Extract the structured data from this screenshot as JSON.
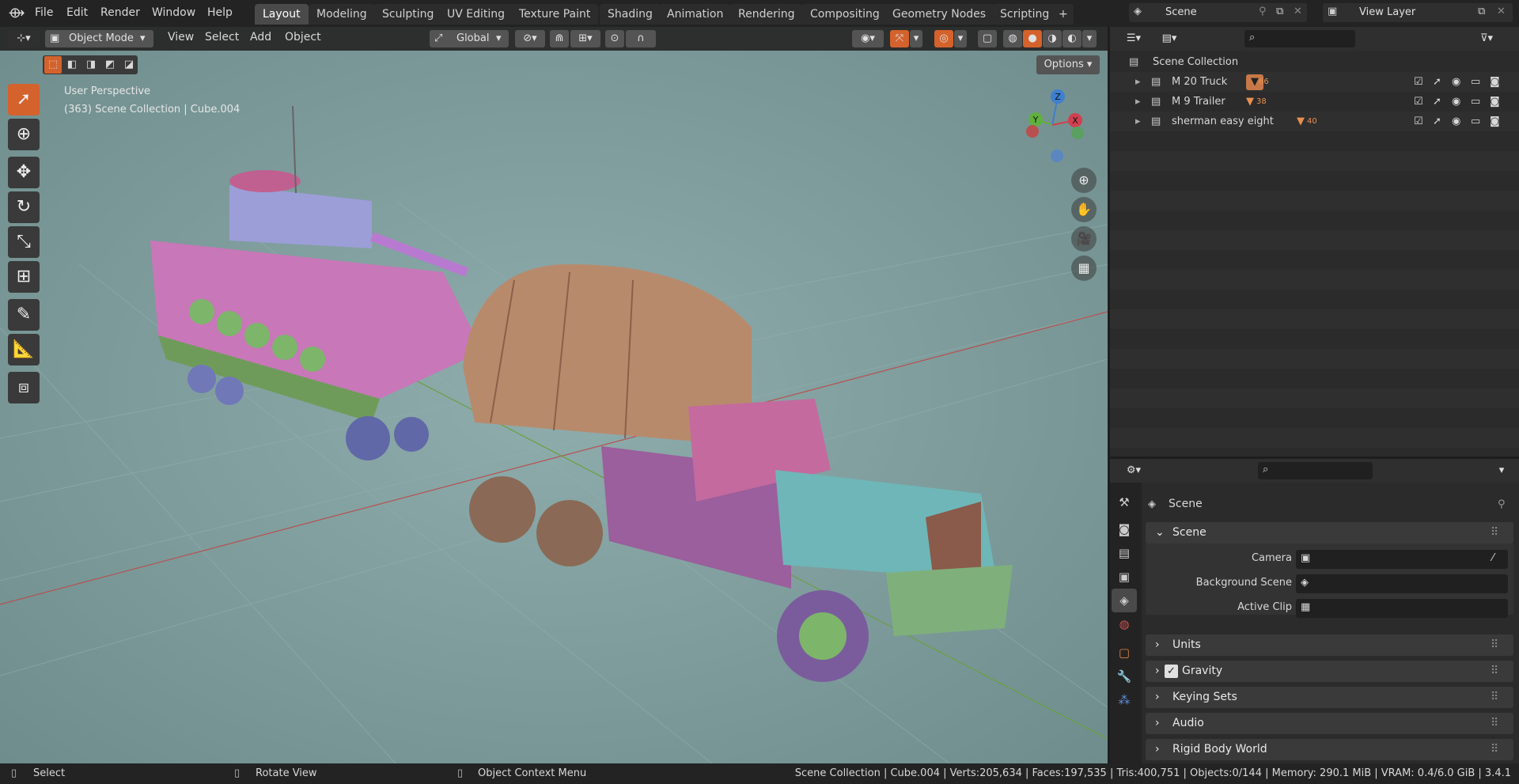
{
  "menus": [
    "File",
    "Edit",
    "Render",
    "Window",
    "Help"
  ],
  "workspaces": [
    "Layout",
    "Modeling",
    "Sculpting",
    "UV Editing",
    "Texture Paint",
    "Shading",
    "Animation",
    "Rendering",
    "Compositing",
    "Geometry Nodes",
    "Scripting"
  ],
  "active_workspace": "Layout",
  "add_tab_symbol": "+",
  "scene_selector": {
    "label": "Scene"
  },
  "view_layer_selector": {
    "label": "View Layer"
  },
  "viewport_header": {
    "mode": "Object Mode",
    "menus": [
      "View",
      "Select",
      "Add",
      "Object"
    ],
    "transform_orientation": "Global",
    "options": "Options"
  },
  "viewport": {
    "perspective": "User Perspective",
    "info": "(363) Scene Collection | Cube.004",
    "axes": {
      "z": "Z",
      "y": "Y",
      "x": "X"
    }
  },
  "outliner": {
    "root": "Scene Collection",
    "rows": [
      {
        "name": "M 20 Truck",
        "count": "66"
      },
      {
        "name": "M 9 Trailer",
        "count": "38"
      },
      {
        "name": "sherman easy eight",
        "count": "40"
      }
    ]
  },
  "properties": {
    "context_title": "Scene",
    "panel_scene": "Scene",
    "fields": [
      {
        "label": "Camera"
      },
      {
        "label": "Background Scene"
      },
      {
        "label": "Active Clip"
      }
    ],
    "panels": [
      "Units",
      "Gravity",
      "Keying Sets",
      "Audio",
      "Rigid Body World"
    ],
    "gravity_checked": true
  },
  "statusbar": {
    "left": [
      "Select",
      "Rotate View",
      "Object Context Menu"
    ],
    "stats": "Scene Collection | Cube.004 | Verts:205,634 | Faces:197,535 | Tris:400,751 | Objects:0/144 | Memory: 290.1 MiB | VRAM: 0.4/6.0 GiB | 3.4.1"
  },
  "colors": {
    "accent": "#d4622c",
    "viewport_bg": "#7f9c9c",
    "active_tab": "#4a4a4a"
  }
}
